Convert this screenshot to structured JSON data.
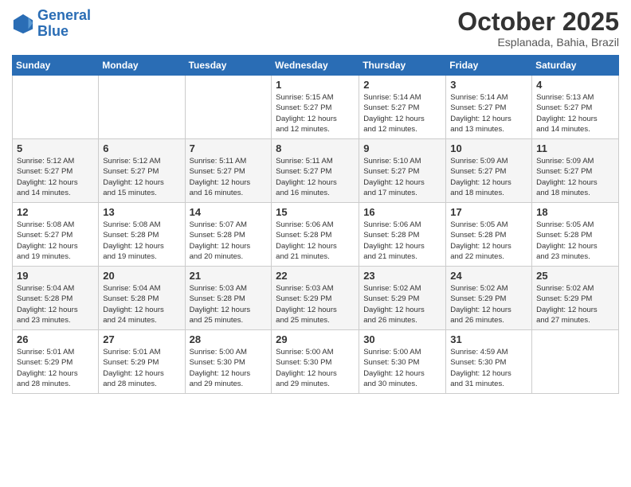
{
  "logo": {
    "text_general": "General",
    "text_blue": "Blue"
  },
  "header": {
    "month": "October 2025",
    "location": "Esplanada, Bahia, Brazil"
  },
  "days_of_week": [
    "Sunday",
    "Monday",
    "Tuesday",
    "Wednesday",
    "Thursday",
    "Friday",
    "Saturday"
  ],
  "weeks": [
    [
      {
        "day": "",
        "info": ""
      },
      {
        "day": "",
        "info": ""
      },
      {
        "day": "",
        "info": ""
      },
      {
        "day": "1",
        "info": "Sunrise: 5:15 AM\nSunset: 5:27 PM\nDaylight: 12 hours\nand 12 minutes."
      },
      {
        "day": "2",
        "info": "Sunrise: 5:14 AM\nSunset: 5:27 PM\nDaylight: 12 hours\nand 12 minutes."
      },
      {
        "day": "3",
        "info": "Sunrise: 5:14 AM\nSunset: 5:27 PM\nDaylight: 12 hours\nand 13 minutes."
      },
      {
        "day": "4",
        "info": "Sunrise: 5:13 AM\nSunset: 5:27 PM\nDaylight: 12 hours\nand 14 minutes."
      }
    ],
    [
      {
        "day": "5",
        "info": "Sunrise: 5:12 AM\nSunset: 5:27 PM\nDaylight: 12 hours\nand 14 minutes."
      },
      {
        "day": "6",
        "info": "Sunrise: 5:12 AM\nSunset: 5:27 PM\nDaylight: 12 hours\nand 15 minutes."
      },
      {
        "day": "7",
        "info": "Sunrise: 5:11 AM\nSunset: 5:27 PM\nDaylight: 12 hours\nand 16 minutes."
      },
      {
        "day": "8",
        "info": "Sunrise: 5:11 AM\nSunset: 5:27 PM\nDaylight: 12 hours\nand 16 minutes."
      },
      {
        "day": "9",
        "info": "Sunrise: 5:10 AM\nSunset: 5:27 PM\nDaylight: 12 hours\nand 17 minutes."
      },
      {
        "day": "10",
        "info": "Sunrise: 5:09 AM\nSunset: 5:27 PM\nDaylight: 12 hours\nand 18 minutes."
      },
      {
        "day": "11",
        "info": "Sunrise: 5:09 AM\nSunset: 5:27 PM\nDaylight: 12 hours\nand 18 minutes."
      }
    ],
    [
      {
        "day": "12",
        "info": "Sunrise: 5:08 AM\nSunset: 5:27 PM\nDaylight: 12 hours\nand 19 minutes."
      },
      {
        "day": "13",
        "info": "Sunrise: 5:08 AM\nSunset: 5:28 PM\nDaylight: 12 hours\nand 19 minutes."
      },
      {
        "day": "14",
        "info": "Sunrise: 5:07 AM\nSunset: 5:28 PM\nDaylight: 12 hours\nand 20 minutes."
      },
      {
        "day": "15",
        "info": "Sunrise: 5:06 AM\nSunset: 5:28 PM\nDaylight: 12 hours\nand 21 minutes."
      },
      {
        "day": "16",
        "info": "Sunrise: 5:06 AM\nSunset: 5:28 PM\nDaylight: 12 hours\nand 21 minutes."
      },
      {
        "day": "17",
        "info": "Sunrise: 5:05 AM\nSunset: 5:28 PM\nDaylight: 12 hours\nand 22 minutes."
      },
      {
        "day": "18",
        "info": "Sunrise: 5:05 AM\nSunset: 5:28 PM\nDaylight: 12 hours\nand 23 minutes."
      }
    ],
    [
      {
        "day": "19",
        "info": "Sunrise: 5:04 AM\nSunset: 5:28 PM\nDaylight: 12 hours\nand 23 minutes."
      },
      {
        "day": "20",
        "info": "Sunrise: 5:04 AM\nSunset: 5:28 PM\nDaylight: 12 hours\nand 24 minutes."
      },
      {
        "day": "21",
        "info": "Sunrise: 5:03 AM\nSunset: 5:28 PM\nDaylight: 12 hours\nand 25 minutes."
      },
      {
        "day": "22",
        "info": "Sunrise: 5:03 AM\nSunset: 5:29 PM\nDaylight: 12 hours\nand 25 minutes."
      },
      {
        "day": "23",
        "info": "Sunrise: 5:02 AM\nSunset: 5:29 PM\nDaylight: 12 hours\nand 26 minutes."
      },
      {
        "day": "24",
        "info": "Sunrise: 5:02 AM\nSunset: 5:29 PM\nDaylight: 12 hours\nand 26 minutes."
      },
      {
        "day": "25",
        "info": "Sunrise: 5:02 AM\nSunset: 5:29 PM\nDaylight: 12 hours\nand 27 minutes."
      }
    ],
    [
      {
        "day": "26",
        "info": "Sunrise: 5:01 AM\nSunset: 5:29 PM\nDaylight: 12 hours\nand 28 minutes."
      },
      {
        "day": "27",
        "info": "Sunrise: 5:01 AM\nSunset: 5:29 PM\nDaylight: 12 hours\nand 28 minutes."
      },
      {
        "day": "28",
        "info": "Sunrise: 5:00 AM\nSunset: 5:30 PM\nDaylight: 12 hours\nand 29 minutes."
      },
      {
        "day": "29",
        "info": "Sunrise: 5:00 AM\nSunset: 5:30 PM\nDaylight: 12 hours\nand 29 minutes."
      },
      {
        "day": "30",
        "info": "Sunrise: 5:00 AM\nSunset: 5:30 PM\nDaylight: 12 hours\nand 30 minutes."
      },
      {
        "day": "31",
        "info": "Sunrise: 4:59 AM\nSunset: 5:30 PM\nDaylight: 12 hours\nand 31 minutes."
      },
      {
        "day": "",
        "info": ""
      }
    ]
  ]
}
